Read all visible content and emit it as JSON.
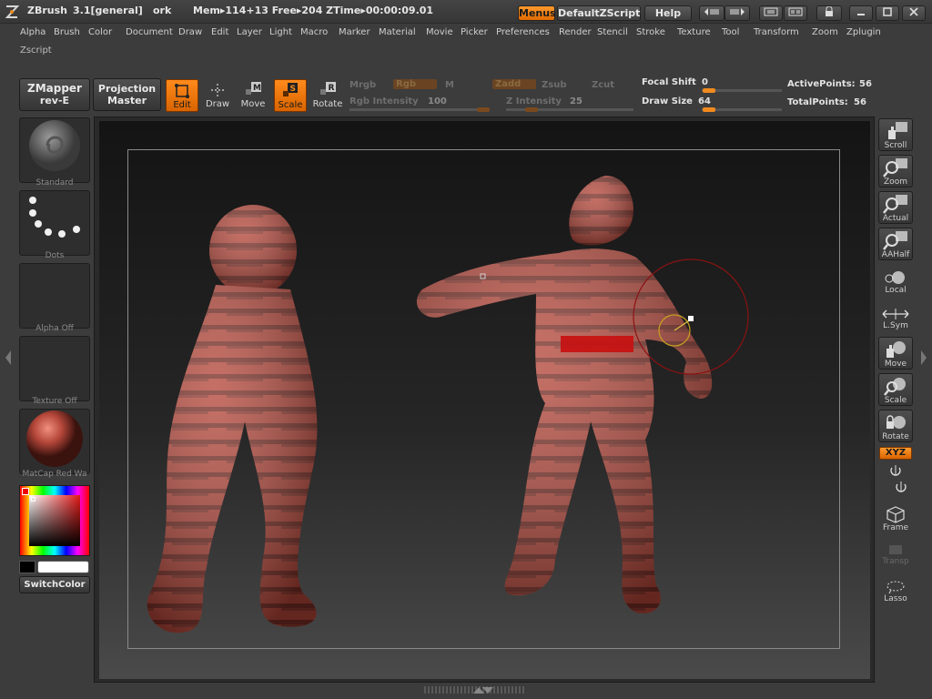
{
  "titlebar": {
    "app": "ZBrush",
    "version": "3.1[general]",
    "doc": "ork",
    "mem": "Mem▸114+13 Free▸204 ZTime▸00:00:09.01",
    "buttons": {
      "menus": "Menus",
      "script": "DefaultZScript",
      "help": "Help"
    }
  },
  "menus": [
    "Alpha",
    "Brush",
    "Color",
    "Document",
    "Draw",
    "Edit",
    "Layer",
    "Light",
    "Macro",
    "Marker",
    "Material",
    "Movie",
    "Picker",
    "Preferences",
    "Render",
    "Stencil",
    "Stroke",
    "Texture",
    "Tool",
    "Transform",
    "Zoom",
    "Zplugin"
  ],
  "zscript": "Zscript",
  "toolbar": {
    "zmapper": "ZMapper",
    "zmapper_sub": "rev-E",
    "projection": "Projection",
    "projection_sub": "Master",
    "tools": {
      "edit": "Edit",
      "draw": "Draw",
      "move": "Move",
      "scale": "Scale",
      "rotate": "Rotate"
    },
    "mrgb": "Mrgb",
    "rgb": "Rgb",
    "m": "M",
    "zadd": "Zadd",
    "zsub": "Zsub",
    "zcut": "Zcut",
    "rgb_intensity_label": "Rgb Intensity",
    "rgb_intensity": "100",
    "z_intensity_label": "Z Intensity",
    "z_intensity": "25",
    "focal_shift_label": "Focal Shift",
    "focal_shift": "0",
    "draw_size_label": "Draw Size",
    "draw_size": "64",
    "active_points_label": "ActivePoints:",
    "active_points": "56",
    "total_points_label": "TotalPoints:",
    "total_points": "56"
  },
  "left_panel": {
    "brush": "Standard",
    "stroke": "Dots",
    "alpha": "Alpha Off",
    "texture": "Texture Off",
    "material": "MatCap Red Wa",
    "switch_color": "SwitchColor"
  },
  "right_panel": {
    "scroll": "Scroll",
    "zoom": "Zoom",
    "actual": "Actual",
    "aahalf": "AAHalf",
    "local": "Local",
    "lsym": "L.Sym",
    "move": "Move",
    "scale": "Scale",
    "rotate": "Rotate",
    "xyz": "XYZ",
    "frame": "Frame",
    "transp": "Transp",
    "lasso": "Lasso"
  },
  "colors": {
    "accent": "#f08a1e",
    "model": "#b5473a",
    "model_dark": "#6e2a24",
    "highlight_band": "#c81010"
  }
}
